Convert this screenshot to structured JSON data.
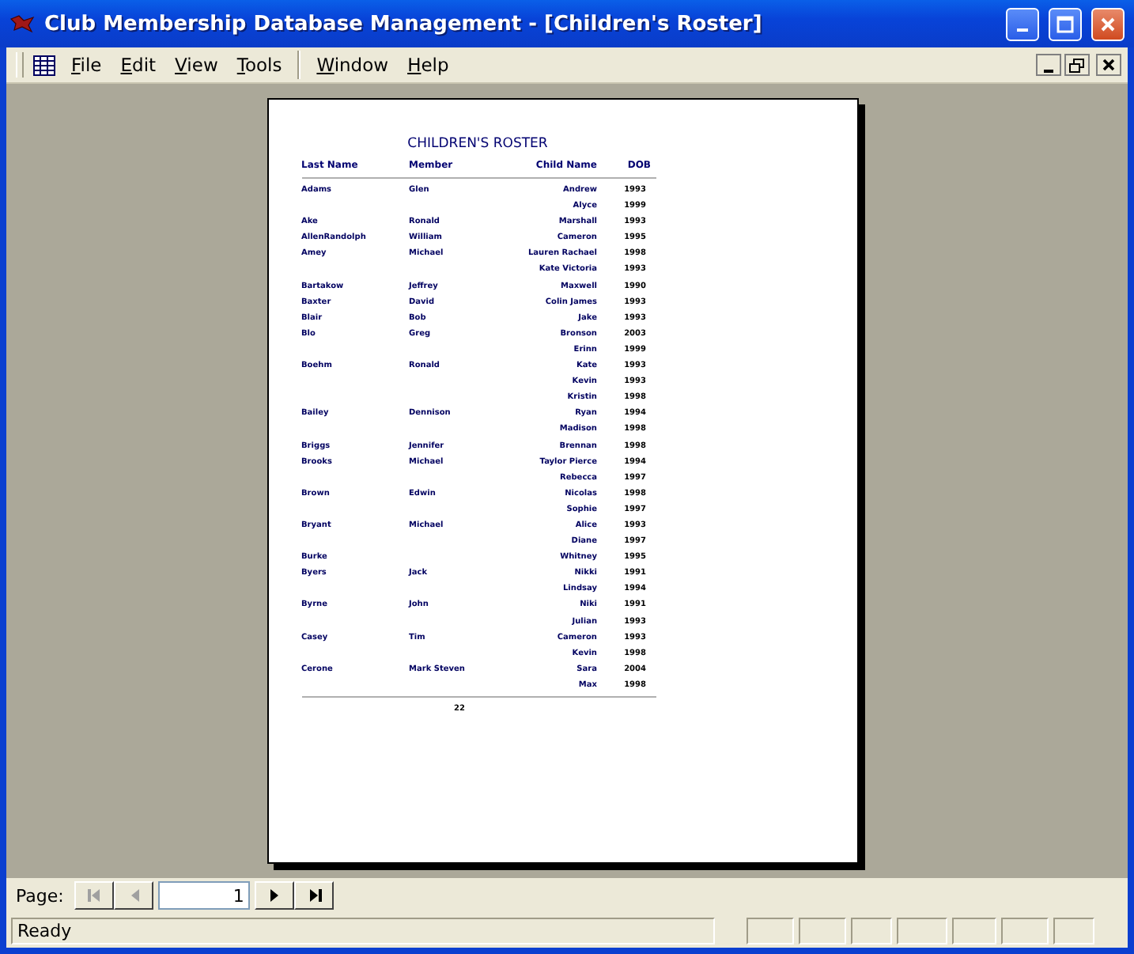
{
  "window": {
    "title": "Club Membership Database Management - [Children's Roster]"
  },
  "menu_groups": [
    [
      "File",
      "Edit",
      "View",
      "Tools"
    ],
    [
      "Window",
      "Help"
    ]
  ],
  "report": {
    "title": "CHILDREN'S ROSTER",
    "columns": [
      "Last Name",
      "Member",
      "Child Name",
      "DOB"
    ],
    "rows": [
      {
        "last_name": "Adams",
        "member": "Glen",
        "child_name": "Andrew",
        "dob": "1993"
      },
      {
        "child_name": "Alyce",
        "dob": "1999"
      },
      {
        "last_name": "Ake",
        "member": "Ronald",
        "child_name": "Marshall",
        "dob": "1993"
      },
      {
        "last_name": "AllenRandolph",
        "member": "William",
        "child_name": "Cameron",
        "dob": "1995"
      },
      {
        "last_name": "Amey",
        "member": "Michael",
        "child_name": "Lauren Rachael",
        "dob": "1998"
      },
      {
        "child_name": "Kate Victoria",
        "dob": "1993"
      },
      {
        "last_name": "Bartakow",
        "member": "Jeffrey",
        "child_name": "Maxwell",
        "dob": "1990"
      },
      {
        "last_name": "Baxter",
        "member": "David",
        "child_name": "Colin James",
        "dob": "1993"
      },
      {
        "last_name": "Blair",
        "member": "Bob",
        "child_name": "Jake",
        "dob": "1993"
      },
      {
        "last_name": "Blo",
        "member": "Greg",
        "child_name": "Bronson",
        "dob": "2003"
      },
      {
        "child_name": "Erinn",
        "dob": "1999"
      },
      {
        "last_name": "Boehm",
        "member": "Ronald",
        "child_name": "Kate",
        "dob": "1993"
      },
      {
        "child_name": "Kevin",
        "dob": "1993"
      },
      {
        "child_name": "Kristin",
        "dob": "1998"
      },
      {
        "last_name": "Bailey",
        "member": "Dennison",
        "child_name": "Ryan",
        "dob": "1994"
      },
      {
        "child_name": "Madison",
        "dob": "1998"
      },
      {
        "last_name": "Briggs",
        "member": "Jennifer",
        "child_name": "Brennan",
        "dob": "1998"
      },
      {
        "last_name": "Brooks",
        "member": "Michael",
        "child_name": "Taylor Pierce",
        "dob": "1994"
      },
      {
        "child_name": "Rebecca",
        "dob": "1997"
      },
      {
        "last_name": "Brown",
        "member": "Edwin",
        "child_name": "Nicolas",
        "dob": "1998"
      },
      {
        "child_name": "Sophie",
        "dob": "1997"
      },
      {
        "last_name": "Bryant",
        "member": "Michael",
        "child_name": "Alice",
        "dob": "1993"
      },
      {
        "child_name": "Diane",
        "dob": "1997"
      },
      {
        "last_name": "Burke",
        "child_name": "Whitney",
        "dob": "1995"
      },
      {
        "last_name": "Byers",
        "member": "Jack",
        "child_name": "Nikki",
        "dob": "1991"
      },
      {
        "child_name": "Lindsay",
        "dob": "1994"
      },
      {
        "last_name": "Byrne",
        "member": "John",
        "child_name": "Niki",
        "dob": "1991"
      },
      {
        "child_name": "Julian",
        "dob": "1993"
      },
      {
        "last_name": "Casey",
        "member": "Tim",
        "child_name": "Cameron",
        "dob": "1993"
      },
      {
        "child_name": "Kevin",
        "dob": "1998"
      },
      {
        "last_name": "Cerone",
        "member": "Mark Steven",
        "child_name": "Sara",
        "dob": "2004"
      },
      {
        "child_name": "Max",
        "dob": "1998"
      }
    ],
    "page_number": "22"
  },
  "navigation": {
    "label": "Page:",
    "page": "1",
    "first_disabled": true,
    "prev_disabled": true,
    "next_disabled": false,
    "last_disabled": false
  },
  "status_bar": {
    "text": "Ready"
  }
}
